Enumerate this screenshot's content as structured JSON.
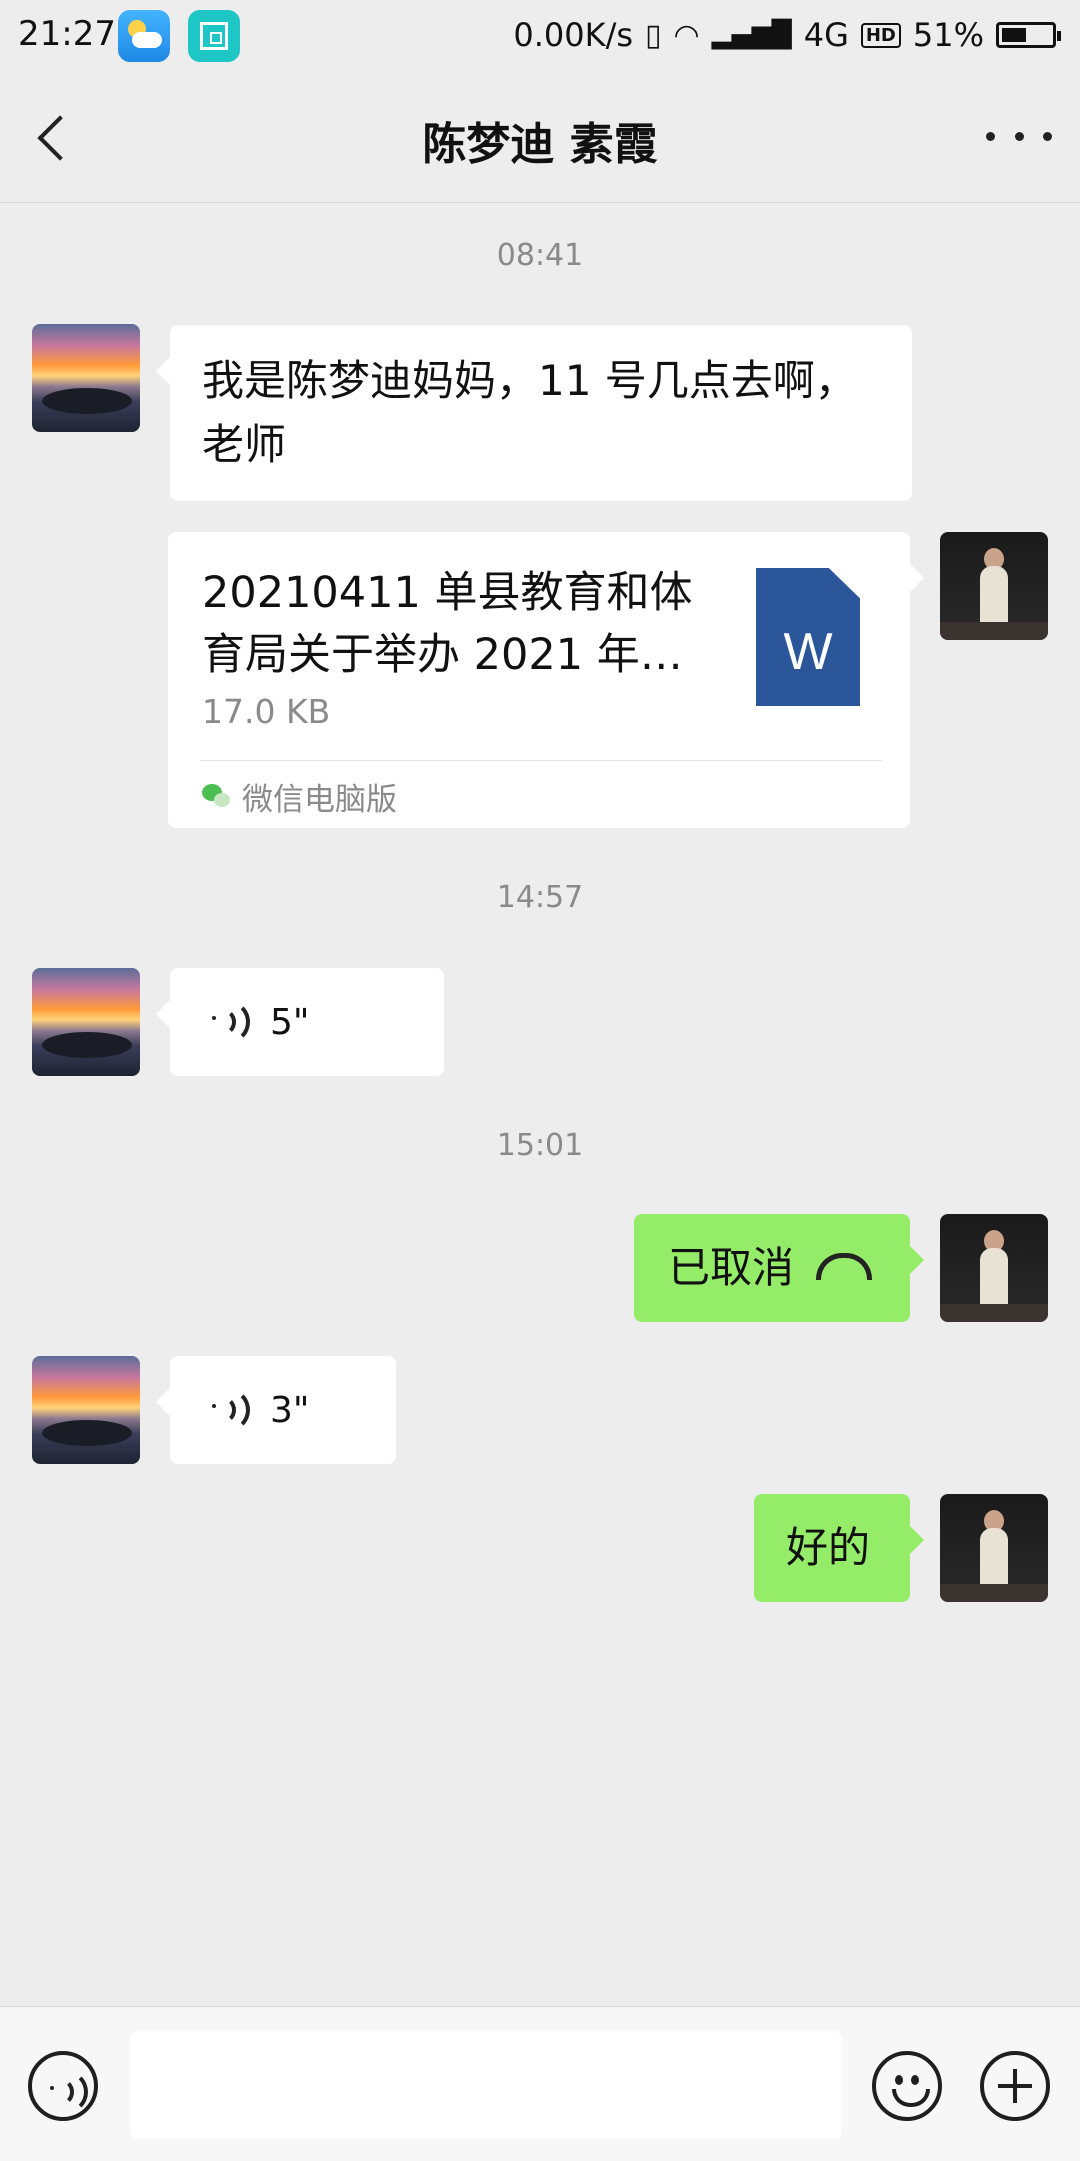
{
  "status_bar": {
    "time": "21:27",
    "net_speed": "0.00K/s",
    "network": "4G",
    "hd": "HD",
    "battery_text": "51%",
    "battery_level": 0.51
  },
  "header": {
    "title": "陈梦迪 素霞"
  },
  "chat": {
    "ts1": "08:41",
    "msg1_text": "我是陈梦迪妈妈，11 号几点去啊，老师",
    "file": {
      "name": "20210411 单县教育和体育局关于举办 2021 年…",
      "size": "17.0 KB",
      "icon_letter": "W",
      "source": "微信电脑版"
    },
    "ts2": "14:57",
    "voice1_duration": "5\"",
    "ts3": "15:01",
    "call_text": "已取消",
    "voice2_duration": "3\"",
    "reply_text": "好的"
  },
  "input_bar": {
    "placeholder": ""
  },
  "colors": {
    "background": "#ededed",
    "bubble_white": "#ffffff",
    "bubble_green": "#95ec69",
    "word_blue": "#2b579a"
  }
}
